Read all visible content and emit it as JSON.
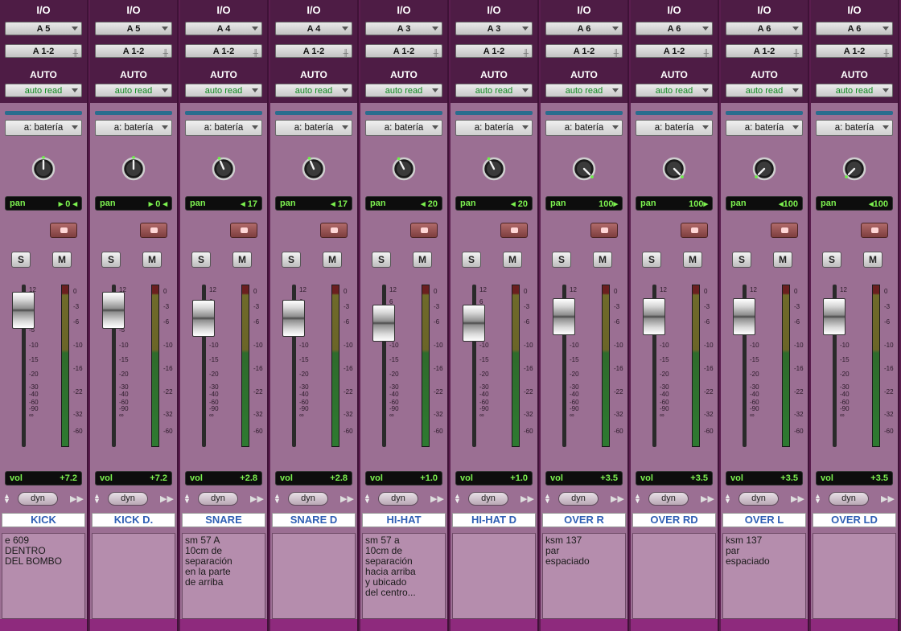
{
  "labels": {
    "io": "I/O",
    "auto": "AUTO",
    "pan": "pan",
    "vol": "vol",
    "solo": "S",
    "mute": "M",
    "dyn": "dyn"
  },
  "colors": {
    "background": "#5a1d4e",
    "strip": "#9b6f93",
    "display_text": "#7cf24f",
    "name_text": "#2e5fb4",
    "auto_text": "#0f8a1f",
    "knob_indicator": "#6ef04a"
  },
  "fader_scale": [
    "12",
    "6",
    "0",
    "-5",
    "-10",
    "-15",
    "-20",
    "-30",
    "-40",
    "-60",
    "-90",
    "∞"
  ],
  "meter_scale": [
    "0",
    "-3",
    "-6",
    "-10",
    "-16",
    "-22",
    "-32",
    "-60"
  ],
  "tracks": [
    {
      "input": "A 5",
      "output": "A 1-2",
      "automation": "auto read",
      "insert": "a: batería",
      "pan": "▸ 0 ◂",
      "pan_value": 0,
      "volume": "+7.2",
      "fader_level": 0.06,
      "name": "KICK",
      "comment": "e 609\nDENTRO\nDEL BOMBO"
    },
    {
      "input": "A 5",
      "output": "A 1-2",
      "automation": "auto read",
      "insert": "a: batería",
      "pan": "▸ 0 ◂",
      "pan_value": 0,
      "volume": "+7.2",
      "fader_level": 0.06,
      "name": "KICK D.",
      "comment": ""
    },
    {
      "input": "A 4",
      "output": "A 1-2",
      "automation": "auto read",
      "insert": "a: batería",
      "pan": "◂ 17",
      "pan_value": -17,
      "volume": "+2.8",
      "fader_level": 0.12,
      "name": "SNARE",
      "comment": "sm 57 A\n10cm de\nseparación\nen la parte\nde arriba"
    },
    {
      "input": "A 4",
      "output": "A 1-2",
      "automation": "auto read",
      "insert": "a: batería",
      "pan": "◂ 17",
      "pan_value": -17,
      "volume": "+2.8",
      "fader_level": 0.12,
      "name": "SNARE D",
      "comment": ""
    },
    {
      "input": "A 3",
      "output": "A 1-2",
      "automation": "auto read",
      "insert": "a: batería",
      "pan": "◂ 20",
      "pan_value": -20,
      "volume": "+1.0",
      "fader_level": 0.16,
      "name": "HI-HAT",
      "comment": "sm 57 a\n10cm de\nseparación\nhacia arriba\ny ubicado\ndel centro..."
    },
    {
      "input": "A 3",
      "output": "A 1-2",
      "automation": "auto read",
      "insert": "a: batería",
      "pan": "◂ 20",
      "pan_value": -20,
      "volume": "+1.0",
      "fader_level": 0.16,
      "name": "HI-HAT D",
      "comment": ""
    },
    {
      "input": "A 6",
      "output": "A 1-2",
      "automation": "auto read",
      "insert": "a: batería",
      "pan": "100▸",
      "pan_value": 100,
      "volume": "+3.5",
      "fader_level": 0.11,
      "name": "OVER R",
      "comment": "ksm 137\npar\nespaciado"
    },
    {
      "input": "A 6",
      "output": "A 1-2",
      "automation": "auto read",
      "insert": "a: batería",
      "pan": "100▸",
      "pan_value": 100,
      "volume": "+3.5",
      "fader_level": 0.11,
      "name": "OVER RD",
      "comment": ""
    },
    {
      "input": "A 6",
      "output": "A 1-2",
      "automation": "auto read",
      "insert": "a: batería",
      "pan": "◂100",
      "pan_value": -100,
      "volume": "+3.5",
      "fader_level": 0.11,
      "name": "OVER L",
      "comment": "ksm 137\npar\nespaciado"
    },
    {
      "input": "A 6",
      "output": "A 1-2",
      "automation": "auto read",
      "insert": "a: batería",
      "pan": "◂100",
      "pan_value": -100,
      "volume": "+3.5",
      "fader_level": 0.11,
      "name": "OVER LD",
      "comment": ""
    }
  ]
}
